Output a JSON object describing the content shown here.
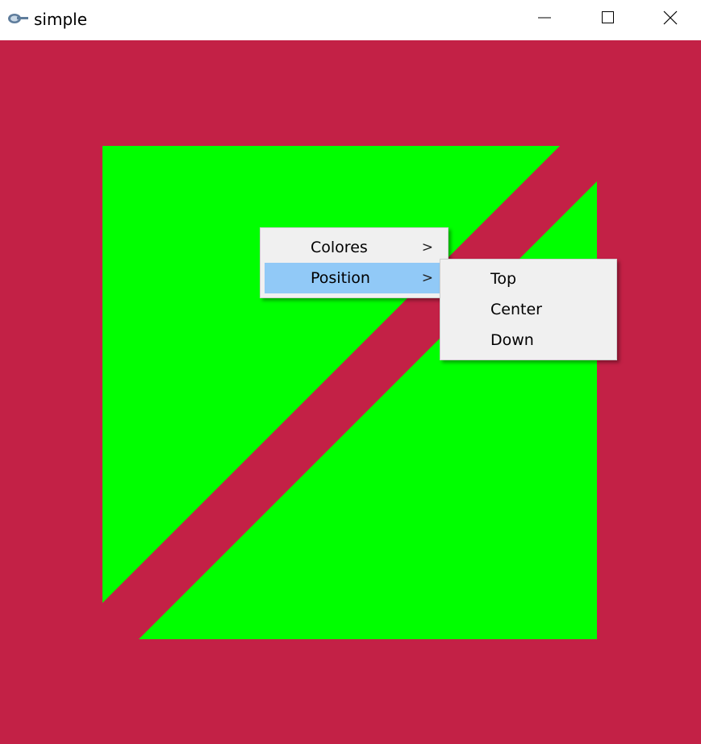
{
  "window": {
    "title": "simple",
    "icons": {
      "app": "eclipse-app-icon",
      "minimize": "minimize-icon",
      "maximize": "maximize-icon",
      "close": "close-icon"
    }
  },
  "canvas": {
    "background_color": "#C32146",
    "shape_color": "#00FF00",
    "shapes": [
      "upper-left-triangle",
      "lower-right-triangle"
    ]
  },
  "context_menu": {
    "items": [
      {
        "label": "Colores",
        "submenu_arrow": ">"
      },
      {
        "label": "Position",
        "submenu_arrow": ">",
        "selected": true
      }
    ],
    "highlight_color": "#91C9F7"
  },
  "position_submenu": {
    "items": [
      {
        "label": "Top"
      },
      {
        "label": "Center"
      },
      {
        "label": "Down"
      }
    ]
  }
}
